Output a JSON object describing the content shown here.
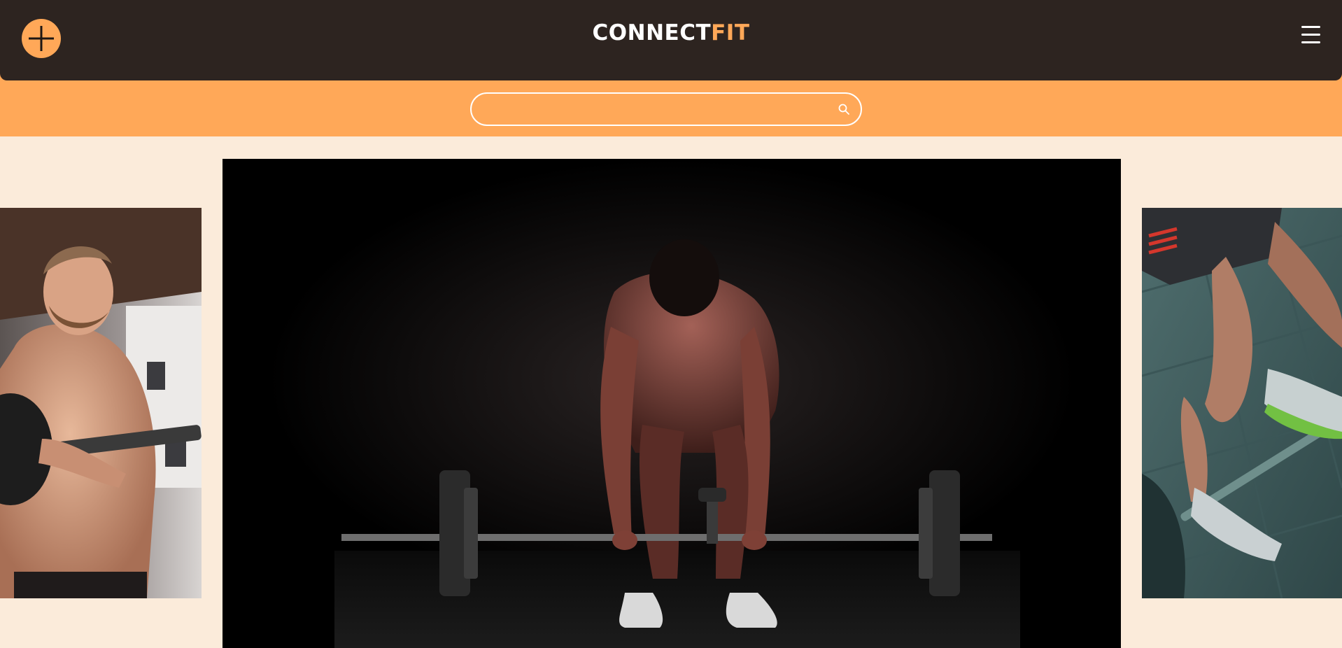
{
  "header": {
    "brand_part1": "CONNECT",
    "brand_part2": "FIT",
    "add_icon": "plus-icon",
    "menu_icon": "hamburger-menu-icon"
  },
  "search": {
    "placeholder": "",
    "value": "",
    "icon": "search-icon"
  },
  "carousel": {
    "slides": [
      {
        "description": "man-with-barbell-curl"
      },
      {
        "description": "man-deadlift-dark-gym"
      },
      {
        "description": "legs-barbell-gym-floor"
      }
    ]
  },
  "colors": {
    "header_bg": "#2D2420",
    "accent": "#FFA858",
    "page_bg": "#FBEBDA",
    "white": "#FFFFFF"
  }
}
